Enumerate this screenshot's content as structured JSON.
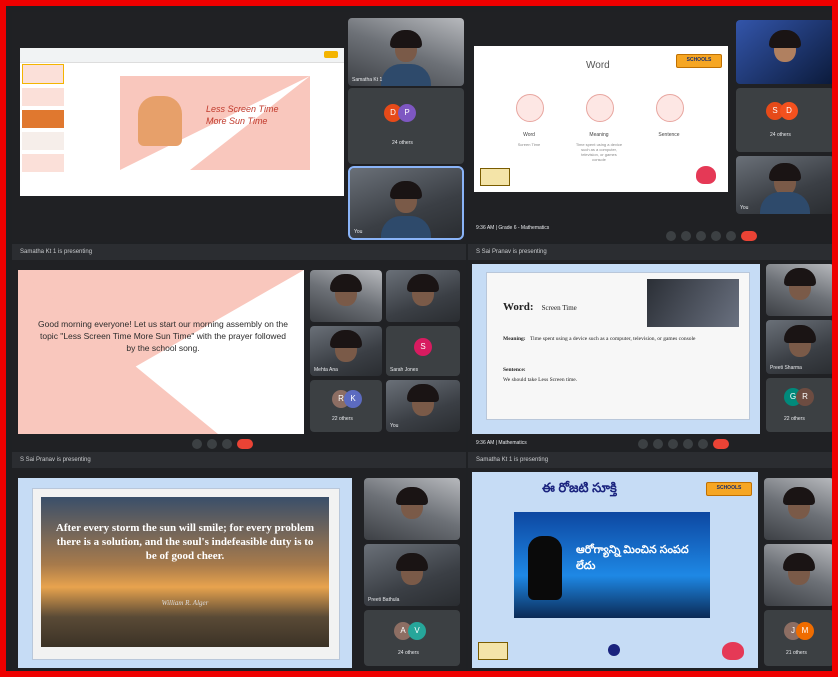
{
  "q1": {
    "slide_title_line1": "Less Screen Time",
    "slide_title_line2": "More Sun Time",
    "tile_a": "Samatha Kt 1",
    "tile_b": "24 others",
    "tile_c": "You"
  },
  "q2": {
    "slide_title": "Word",
    "col1_label": "Word",
    "col1_sub": "Screen Time",
    "col2_label": "Meaning",
    "col2_sub": "Time spent using a device such as a computer, television, or games console",
    "col3_label": "Sentence",
    "logo": "SCHOOLS",
    "status_left": "9:36 AM | Grade 6 - Mathematics",
    "tile_b": "24 others",
    "tile_c": "You",
    "avatar_s": "S",
    "avatar_d": "D"
  },
  "q3": {
    "bar_text": "Samatha Kt 1 is presenting",
    "slide_text": "Good morning everyone! Let us start our morning assembly on the topic \"Less Screen Time More Sun Time\" with the prayer followed by the school song.",
    "tile_3": "Mehta Ana",
    "tile_4": "Sarah Jones",
    "tile_5": "22 others",
    "tile_6": "You"
  },
  "q4": {
    "bar_text": "S Sai Pranav is presenting",
    "word_label": "Word:",
    "word_value": "Screen Time",
    "meaning_label": "Meaning:",
    "meaning_value": "Time spent using a device such as a computer, television, or games console",
    "sentence_label": "Sentence:",
    "sentence_value": "We should take Less Screen time.",
    "status_left": "9:36 AM | Mathematics",
    "tile_2": "Preeti Sharma",
    "tile_3": "22 others"
  },
  "q5": {
    "bar_text": "S Sai Pranav is presenting",
    "quote": "After every storm the sun will smile; for every problem there is a solution, and the soul's indefeasible duty is to be of good cheer.",
    "author": "William R. Alger",
    "tile_2": "Preeti Bathula",
    "tile_3": "24 others"
  },
  "q6": {
    "bar_text": "Samatha Kt 1 is presenting",
    "heading": "ఈ రోజటి సూక్తి",
    "quote": "ఆరోగ్యాన్ని మించిన సంపద లేదు",
    "logo": "SCHOOLS",
    "tile_3": "21 others"
  },
  "colors": {
    "frame": "#ee0000",
    "meet_bg": "#202124",
    "accent_pink": "#f9c0b8",
    "slide_blue": "#c6dcf5"
  }
}
